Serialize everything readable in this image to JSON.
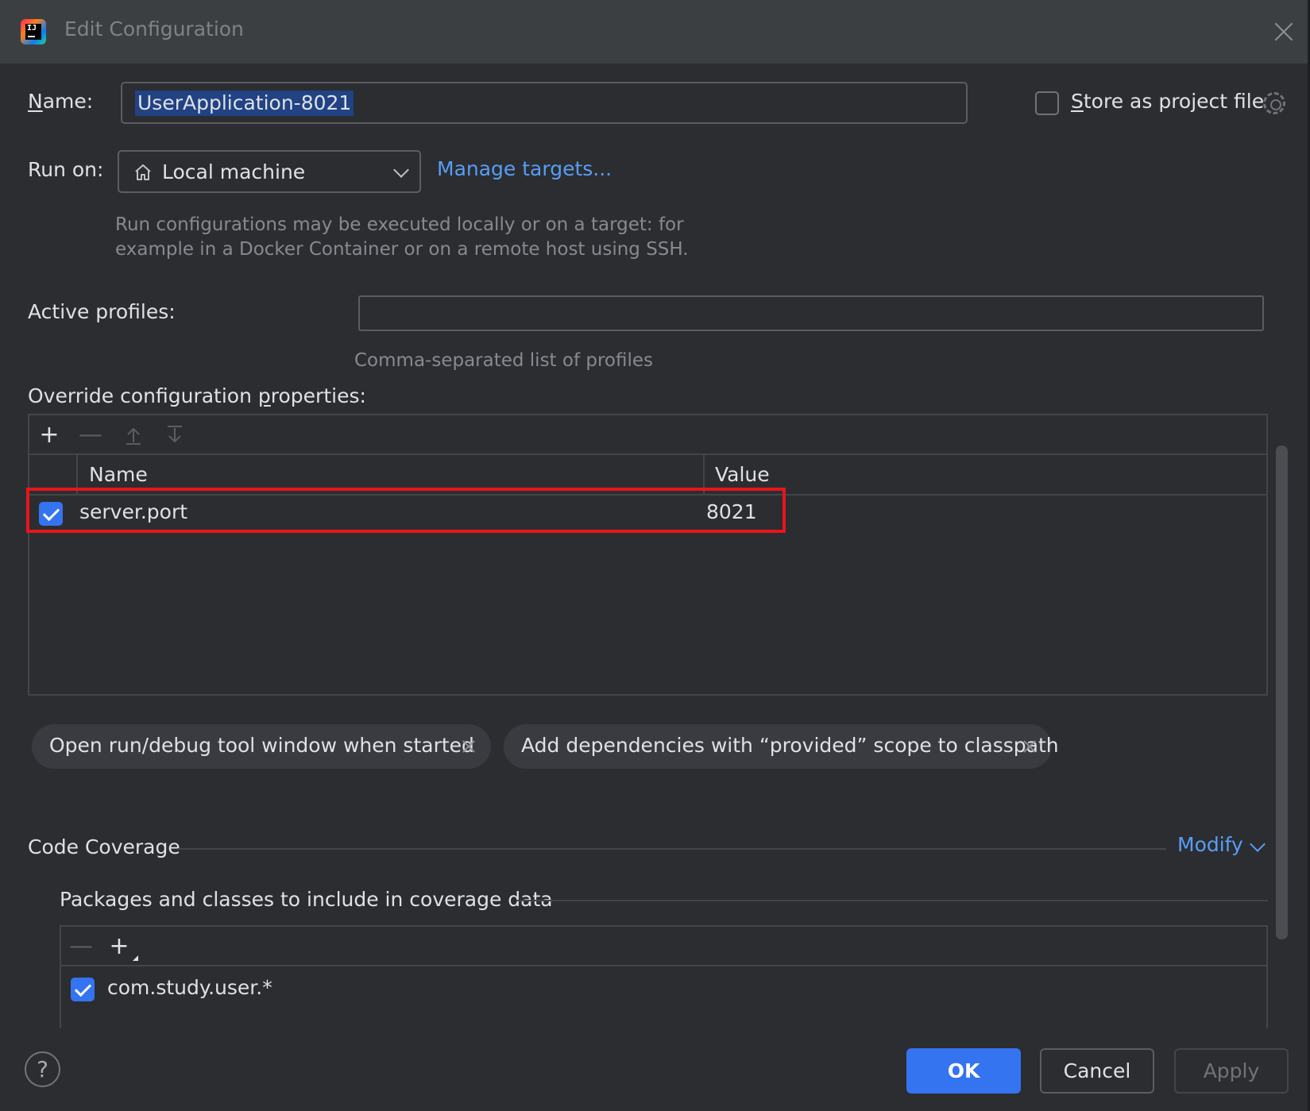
{
  "window": {
    "title": "Edit Configuration"
  },
  "name_field": {
    "label_first": "N",
    "label_rest": "ame:",
    "value": "UserApplication-8021"
  },
  "store_project": {
    "label_first": "S",
    "label_rest": "tore as project file",
    "checked": false
  },
  "run_on": {
    "label": "Run on:",
    "selected": "Local machine",
    "manage_link": "Manage targets...",
    "hint_line1": "Run configurations may be executed locally or on a target: for",
    "hint_line2": "example in a Docker Container or on a remote host using SSH."
  },
  "active_profiles": {
    "label": "Active profiles:",
    "value": "",
    "hint": "Comma-separated list of profiles"
  },
  "override": {
    "label_before": "Override configuration ",
    "label_u": "p",
    "label_after": "roperties:",
    "columns": [
      "Name",
      "Value"
    ],
    "rows": [
      {
        "checked": true,
        "name": "server.port",
        "value": "8021"
      }
    ]
  },
  "chips": [
    {
      "label": "Open run/debug tool window when started"
    },
    {
      "label": "Add dependencies with “provided” scope to classpath"
    }
  ],
  "code_coverage": {
    "section_title": "Code Coverage",
    "modify_link": "Modify",
    "packages_title": "Packages and classes to include in coverage data",
    "items": [
      {
        "checked": true,
        "pattern": "com.study.user.*"
      }
    ]
  },
  "buttons": {
    "ok": "OK",
    "cancel": "Cancel",
    "apply": "Apply",
    "help": "?"
  },
  "colors": {
    "accent": "#3574f0",
    "link": "#589df6",
    "highlight_border": "#e8151b",
    "background": "#2b2d30"
  }
}
